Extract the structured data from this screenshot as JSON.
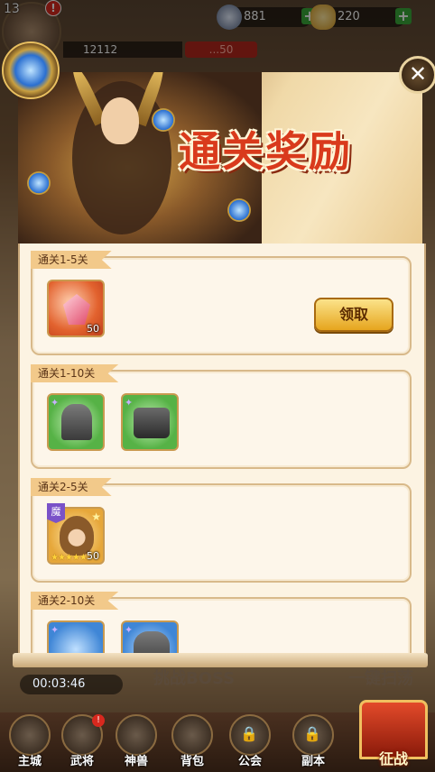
{
  "topbar": {
    "level": "13",
    "alert_mark": "!",
    "gems": "881",
    "gold": "220",
    "power": "12112",
    "redbar_text": "...50"
  },
  "modal": {
    "title": "通关奖励",
    "close_icon": "close-x"
  },
  "rewards": [
    {
      "tag": "通关1-5关",
      "items": [
        {
          "type": "crystal",
          "count": "50",
          "color": "#e2622e"
        }
      ],
      "claim_label": "领取"
    },
    {
      "tag": "通关1-10关",
      "items": [
        {
          "type": "helmet",
          "count": "",
          "color": "#56b246"
        },
        {
          "type": "boots",
          "count": "",
          "color": "#56b246"
        }
      ]
    },
    {
      "tag": "通关2-5关",
      "items": [
        {
          "type": "hero",
          "count": "50",
          "badge": "魔",
          "stars": "★★★★★",
          "color": "#e6a73a"
        }
      ]
    },
    {
      "tag": "通关2-10关",
      "items": [
        {
          "type": "weapon",
          "count": "",
          "color": "#3f86d6"
        },
        {
          "type": "armor",
          "count": "",
          "color": "#3f86d6"
        }
      ]
    }
  ],
  "bottom": {
    "timer": "00:03:46",
    "boss_label": "挑战BOSS",
    "sweep_label": "一键扫荡"
  },
  "nav": [
    {
      "label": "主城",
      "locked": false,
      "badge": ""
    },
    {
      "label": "武将",
      "locked": false,
      "badge": "!"
    },
    {
      "label": "神兽",
      "locked": false,
      "badge": ""
    },
    {
      "label": "背包",
      "locked": false,
      "badge": ""
    },
    {
      "label": "公会",
      "locked": true,
      "badge": ""
    },
    {
      "label": "副本",
      "locked": true,
      "badge": ""
    },
    {
      "label": "征战",
      "locked": false,
      "badge": ""
    }
  ]
}
